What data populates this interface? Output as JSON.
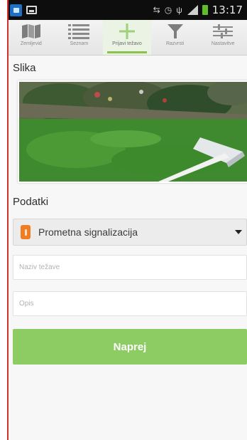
{
  "status_bar": {
    "time": "13:17",
    "icons": [
      "app-icon",
      "image-icon",
      "sync-icon",
      "alarm-icon",
      "usb-icon",
      "signal-icon",
      "battery-icon"
    ]
  },
  "tabs": [
    {
      "label": "Zemljevid",
      "icon": "map-icon",
      "active": false
    },
    {
      "label": "Seznam",
      "icon": "list-icon",
      "active": false
    },
    {
      "label": "Prijavi težavo",
      "icon": "plus-icon",
      "active": true
    },
    {
      "label": "Razvrsti",
      "icon": "filter-icon",
      "active": false
    },
    {
      "label": "Nastavitve",
      "icon": "sliders-icon",
      "active": false
    }
  ],
  "image_section": {
    "title": "Slika"
  },
  "data_section": {
    "title": "Podatki",
    "category": {
      "selected": "Prometna signalizacija",
      "icon": "warning-sign-icon"
    },
    "name_field": {
      "placeholder": "Naziv težave",
      "value": ""
    },
    "description_field": {
      "placeholder": "Opis",
      "value": ""
    },
    "next_button": "Naprej"
  },
  "colors": {
    "accent": "#8ccc63",
    "status_bar": "#0d0d0d",
    "category_icon": "#f07d22"
  }
}
